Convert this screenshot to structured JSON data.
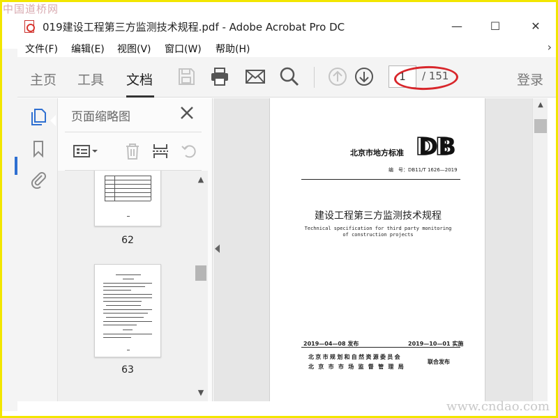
{
  "watermark": {
    "top": "中国道桥网",
    "bottom": "www.cndao.com"
  },
  "window": {
    "title": "019建设工程第三方监测技术规程.pdf - Adobe Acrobat Pro DC",
    "minimize": "—",
    "maximize": "☐",
    "close": "✕"
  },
  "menu": {
    "file": "文件(F)",
    "edit": "编辑(E)",
    "view": "视图(V)",
    "window": "窗口(W)",
    "help": "帮助(H)",
    "more": "›"
  },
  "toolbar": {
    "home": "主页",
    "tools": "工具",
    "document": "文档",
    "page_current": "1",
    "page_total": "/ 151",
    "login": "登录"
  },
  "thumbnails": {
    "title": "页面缩略图",
    "pages": [
      {
        "label": "62"
      },
      {
        "label": "63"
      }
    ]
  },
  "document": {
    "standard_label": "北京市地方标准",
    "logo": "DB",
    "doc_no": "编　号：DB11/T 1626—2019",
    "title": "建设工程第三方监测技术规程",
    "subtitle_line1": "Technical specification for third party monitoring",
    "subtitle_line2": "of construction projects",
    "issue_date": "2019—04—08 发布",
    "impl_date": "2019—10—01 实施",
    "org1": "北京市规划和自然资源委员会",
    "org2": "北京市市场监督管理局",
    "joint": "联合发布"
  },
  "colors": {
    "accent_blue": "#2e6fd1",
    "annotation_red": "#d8262b",
    "frame_yellow": "#f2e600"
  }
}
